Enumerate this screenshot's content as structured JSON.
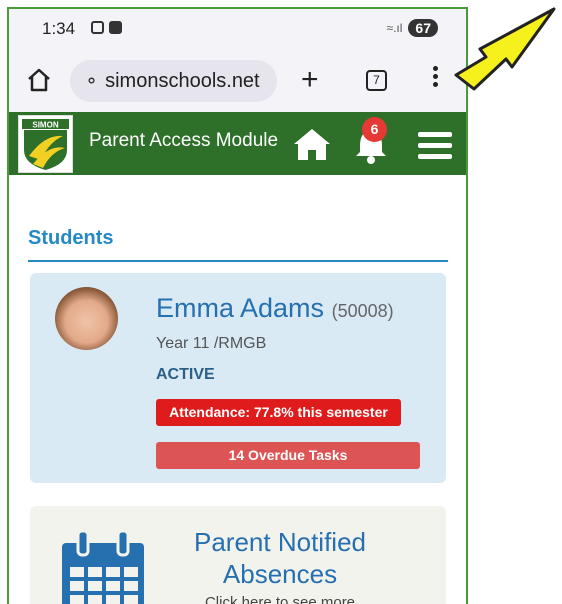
{
  "status_bar": {
    "time": "1:34",
    "battery": "67"
  },
  "browser": {
    "url": "simonschools.net",
    "tab_count": "7"
  },
  "app": {
    "logo_text": "SIMON",
    "title": "Parent Access Module",
    "notification_count": "6"
  },
  "students": {
    "section_title": "Students",
    "student": {
      "name": "Emma Adams",
      "id": "(50008)",
      "year": "Year 11 /RMGB",
      "status": "ACTIVE",
      "attendance": "Attendance: 77.8% this semester",
      "overdue": "14 Overdue Tasks"
    }
  },
  "absences_card": {
    "title": "Parent Notified Absences",
    "subtitle": "Click here to see more"
  },
  "colors": {
    "header_green": "#2e6f2a",
    "accent_blue": "#2589c6",
    "alert_red": "#e01b1b",
    "arrow_yellow": "#f6f01c"
  }
}
